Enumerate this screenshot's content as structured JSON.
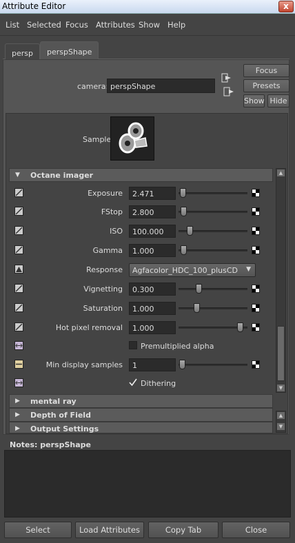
{
  "window": {
    "title": "Attribute Editor",
    "close_glyph": "x"
  },
  "menu": [
    "List",
    "Selected",
    "Focus",
    "Attributes",
    "Show",
    "Help"
  ],
  "tabs": [
    "persp",
    "perspShape"
  ],
  "camera": {
    "label": "camera:",
    "value": "perspShape"
  },
  "buttons": {
    "focus": "Focus",
    "presets": "Presets",
    "show": "Show",
    "hide": "Hide"
  },
  "sample": {
    "label": "Sample"
  },
  "section": {
    "title": "Octane imager"
  },
  "attributes": {
    "exposure": {
      "label": "Exposure",
      "value": "2.471",
      "slider": 0.02
    },
    "fstop": {
      "label": "FStop",
      "value": "2.800",
      "slider": 0.03
    },
    "iso": {
      "label": "ISO",
      "value": "100.000",
      "slider": 0.13
    },
    "gamma": {
      "label": "Gamma",
      "value": "1.000",
      "slider": 0.03
    },
    "response": {
      "label": "Response",
      "value": "Agfacolor_HDC_100_plusCD"
    },
    "vignetting": {
      "label": "Vignetting",
      "value": "0.300",
      "slider": 0.28
    },
    "saturation": {
      "label": "Saturation",
      "value": "1.000",
      "slider": 0.24
    },
    "hotpixel": {
      "label": "Hot pixel removal",
      "value": "1.000",
      "slider": 0.93
    },
    "premult": {
      "label": "Premultiplied alpha",
      "checked": false
    },
    "mindisplay": {
      "label": "Min display samples",
      "value": "1",
      "slider": 0.01
    },
    "dithering": {
      "label": "Dithering",
      "checked": true
    }
  },
  "collapsed_sections": [
    "mental ray",
    "Depth of Field",
    "Output Settings"
  ],
  "notes": {
    "label": "Notes:  perspShape"
  },
  "bottom_buttons": [
    "Select",
    "Load Attributes",
    "Copy Tab",
    "Close"
  ]
}
